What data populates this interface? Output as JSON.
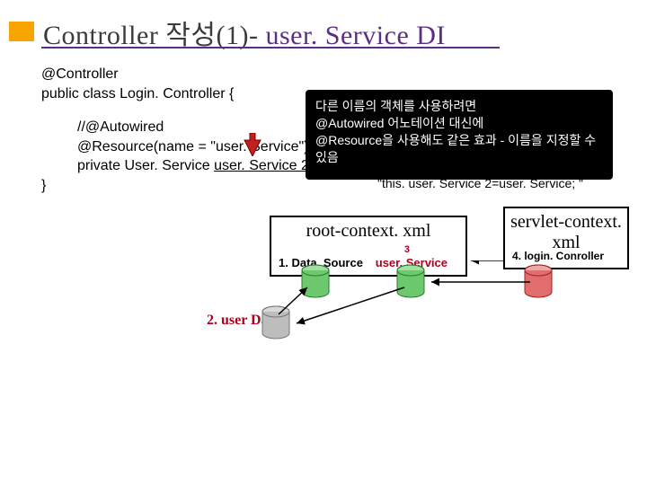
{
  "accent_color": "#f7a400",
  "header": {
    "title_main": "Controller 작성(1)- ",
    "title_sub": "user. Service  DI"
  },
  "code": {
    "l1": "@Controller",
    "l2": "public class Login. Controller {",
    "l3": "//@Autowired",
    "l4": "@Resource(name = \"user. Service\")",
    "l5": "private User. Service ",
    "l5u": "user. Service 2;",
    "l6": "}"
  },
  "tooltip": {
    "line1": "다른 이름의 객체를 사용하려면",
    "line2": "@Autowired 어노테이션 대신에",
    "line3": "@Resource을 사용해도 같은 효과 - 이름을 지정할 수 있음",
    "quote": "\"this. user. Service 2=user. Service; \""
  },
  "boxes": {
    "root_title": "root-context. xml",
    "root_sub1": "1. Data. Source",
    "root_sub2": "user. Service",
    "root_num3": "3",
    "servlet_title": "servlet-context. xml",
    "servlet_sub": "4. login. Conroller"
  },
  "dao_label": "2. user Dao",
  "icons": {
    "cylinder_red": "cylinder-icon-red",
    "cylinder_green": "cylinder-icon-green",
    "cylinder_grey": "cylinder-icon-grey"
  }
}
